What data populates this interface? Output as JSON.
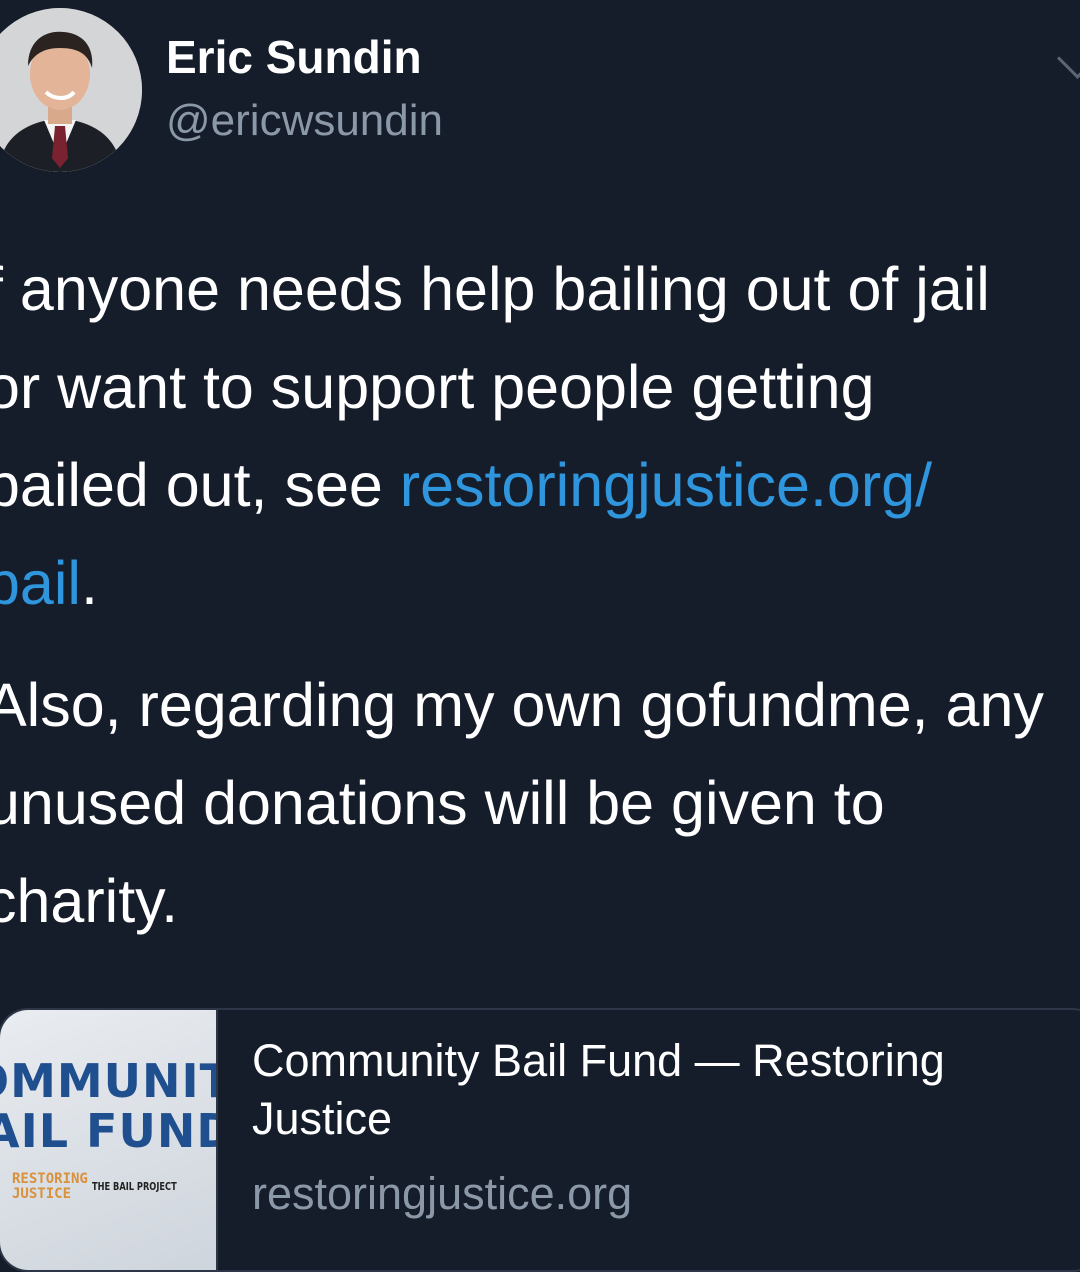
{
  "author": {
    "name": "Eric Sundin",
    "handle": "@ericwsundin",
    "avatar_icon": "profile-photo"
  },
  "tweet": {
    "line1": "f anyone needs help bailing out of jail",
    "line2": "or want to support people getting",
    "line3_text": "bailed out, see ",
    "line3_link": "restoringjustice.org/",
    "line4_link": "bail",
    "line4_text": ".",
    "line5": "Also, regarding my own gofundme, any",
    "line6": "unused donations will be given to",
    "line7": "charity."
  },
  "link_card": {
    "thumbnail": {
      "line1": "OMMUNIT",
      "line2": "AIL FUND",
      "logo1": "RESTORING\nJUSTICE",
      "logo2": "THE BAIL PROJECT"
    },
    "title": "Community Bail Fund — Restoring Justice",
    "domain": "restoringjustice.org"
  },
  "colors": {
    "background": "#151c2a",
    "link": "#2f95dc",
    "secondary_text": "#8b98a8"
  }
}
